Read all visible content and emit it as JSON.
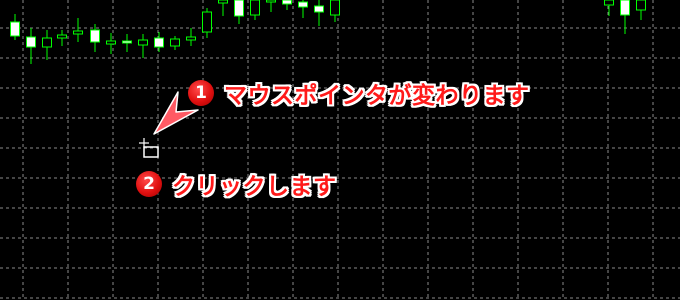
{
  "chart": {
    "background": "#000000",
    "grid_color": "#8a8a8a",
    "candle_up_fill": "#ffffff",
    "candle_down_fill": "#000000",
    "candle_color": "#00ff00",
    "grid_style": "dashed"
  },
  "callouts": [
    {
      "number": "1",
      "text": "マウスポインタが変わります"
    },
    {
      "number": "2",
      "text": "クリックします"
    }
  ],
  "annotation": {
    "badge_color": "#e01010",
    "text_color": "#ff1a1a",
    "arrow_color": "#ff5a64"
  },
  "cursor": {
    "icon": "rectangle-draw-cursor-icon"
  }
}
